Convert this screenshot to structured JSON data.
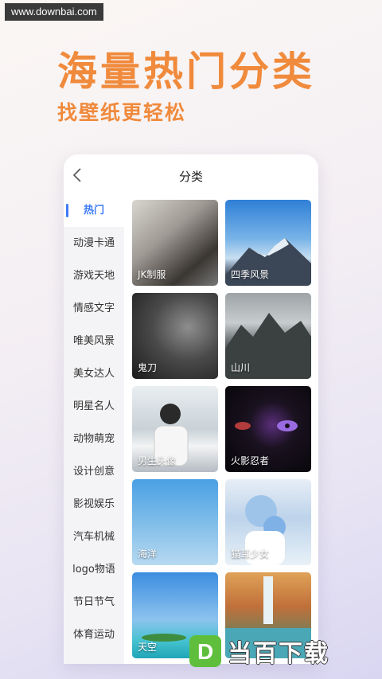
{
  "watermark": "www.downbai.com",
  "promo": {
    "title": "海量热门分类",
    "subtitle": "找壁纸更轻松"
  },
  "app": {
    "title": "分类",
    "back_icon": "chevron-left-icon",
    "categories": [
      "热门",
      "动漫卡通",
      "游戏天地",
      "情感文字",
      "唯美风景",
      "美女达人",
      "明星名人",
      "动物萌宠",
      "设计创意",
      "影视娱乐",
      "汽车机械",
      "logo物语",
      "节日节气",
      "体育运动"
    ],
    "active_category": "热门",
    "tiles": [
      "JK制服",
      "四季风景",
      "鬼刀",
      "山川",
      "男生头像",
      "火影忍者",
      "海洋",
      "猫耳少女",
      "天空",
      ""
    ]
  },
  "bottom_logo": {
    "mark": "D",
    "text": "当百下载"
  },
  "colors": {
    "accent_orange": "#f08a3c",
    "active_blue": "#3d7bf7",
    "logo_green": "#5fbf3c"
  }
}
